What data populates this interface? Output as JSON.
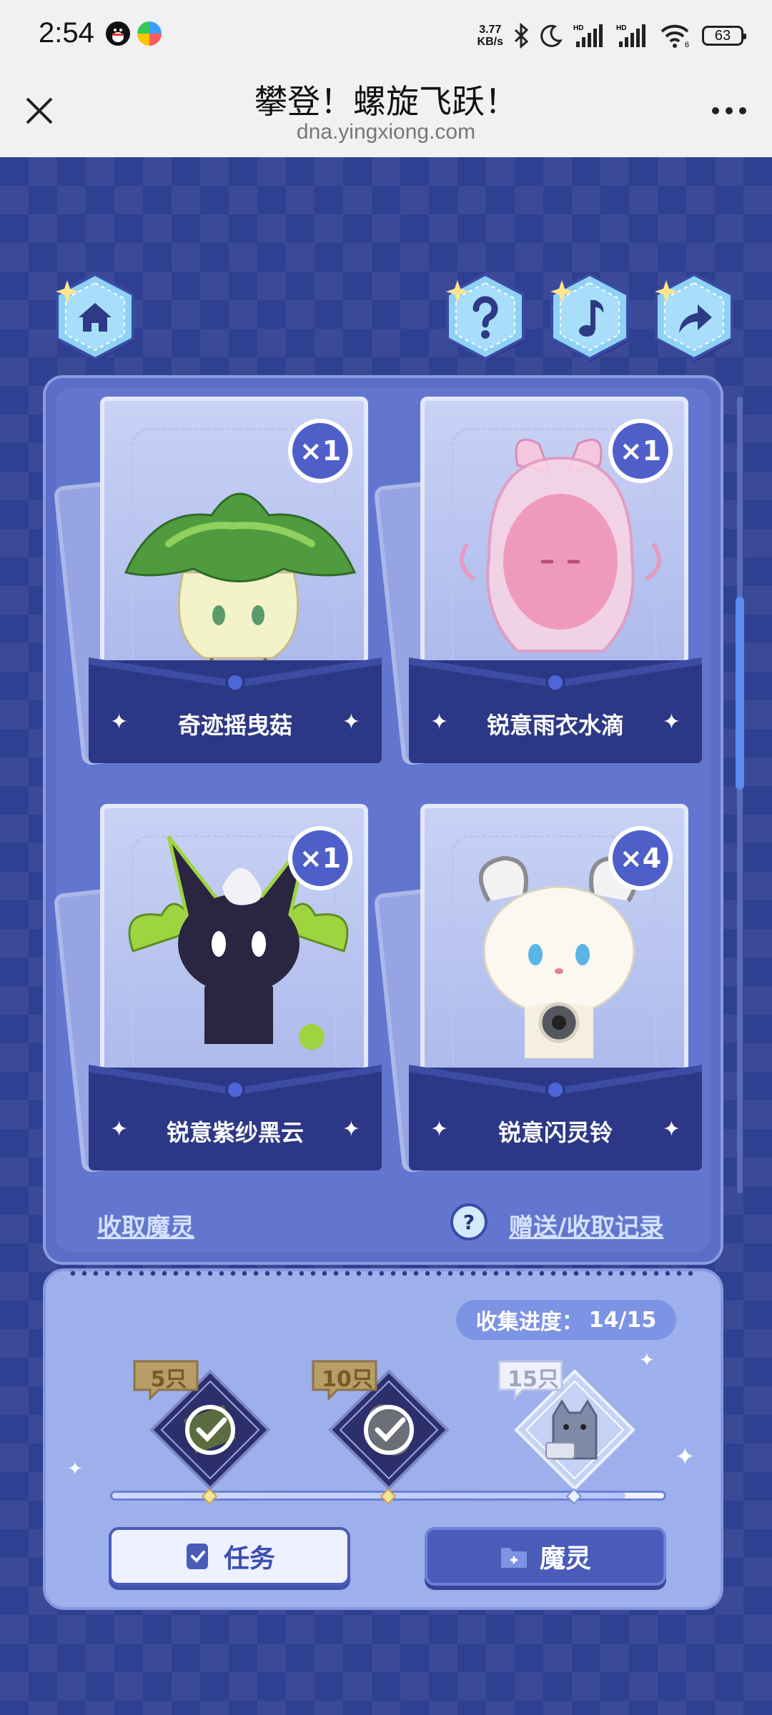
{
  "status_bar": {
    "time": "2:54",
    "net_speed_value": "3.77",
    "net_speed_unit": "KB/s",
    "battery": "63"
  },
  "title_bar": {
    "title": "攀登！螺旋飞跃！",
    "url": "dna.yingxiong.com"
  },
  "top_icons": [
    "home-icon",
    "help-icon",
    "music-icon",
    "share-icon"
  ],
  "cards": [
    {
      "name": "奇迹摇曳菇",
      "count": "×1"
    },
    {
      "name": "锐意雨衣水滴",
      "count": "×1"
    },
    {
      "name": "锐意紫纱黑云",
      "count": "×1"
    },
    {
      "name": "锐意闪灵铃",
      "count": "×4"
    }
  ],
  "links": {
    "collect": "收取魔灵",
    "help_symbol": "?",
    "records": "赠送/收取记录"
  },
  "progress": {
    "label": "收集进度：",
    "value": "14/15",
    "fraction": 0.93,
    "milestones": [
      {
        "label": "5只",
        "claimed": true
      },
      {
        "label": "10只",
        "claimed": true
      },
      {
        "label": "15只",
        "claimed": false
      }
    ]
  },
  "buttons": {
    "task": "任务",
    "spirit": "魔灵"
  },
  "colors": {
    "background": "#2f3f91",
    "panel": "#5a6dc7",
    "accent": "#4a5bb9",
    "link": "#d4e2ff"
  }
}
